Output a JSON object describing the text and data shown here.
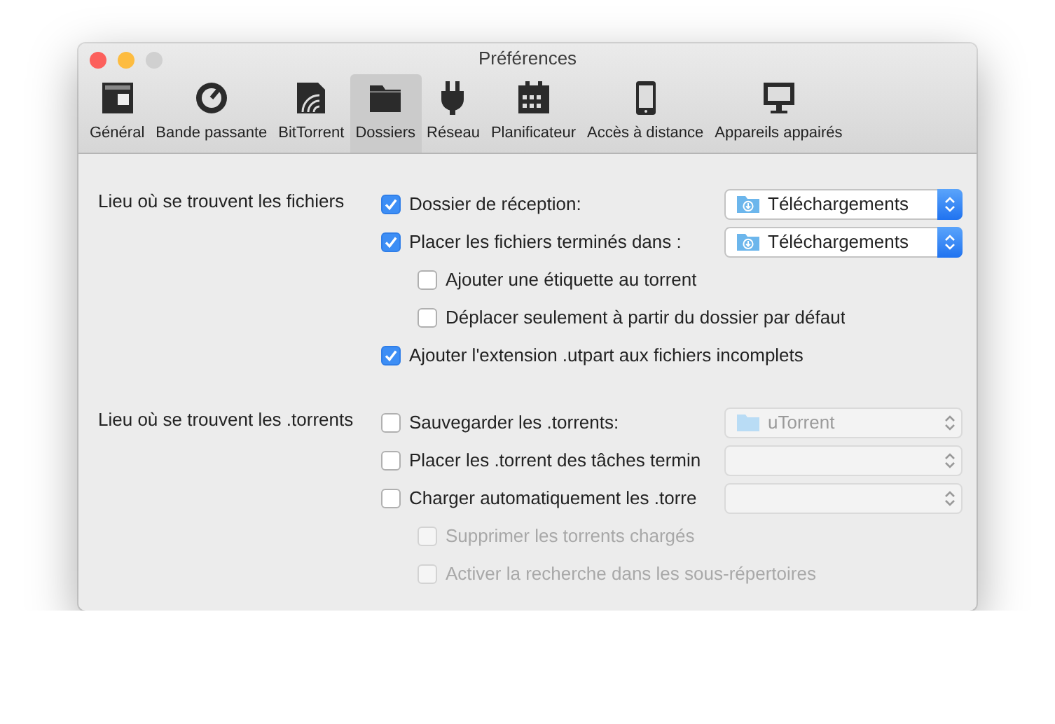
{
  "window": {
    "title": "Préférences"
  },
  "toolbar": [
    {
      "label": "Général",
      "selected": false
    },
    {
      "label": "Bande passante",
      "selected": false
    },
    {
      "label": "BitTorrent",
      "selected": false
    },
    {
      "label": "Dossiers",
      "selected": true
    },
    {
      "label": "Réseau",
      "selected": false
    },
    {
      "label": "Planificateur",
      "selected": false
    },
    {
      "label": "Accès à distance",
      "selected": false
    },
    {
      "label": "Appareils appairés",
      "selected": false
    }
  ],
  "sections": [
    {
      "label": "Lieu où se trouvent les fichiers",
      "options": [
        {
          "label": "Dossier de réception:",
          "checked": true,
          "disabled": false,
          "popup": {
            "value": "Téléchargements",
            "disabled": false
          }
        },
        {
          "label": "Placer les fichiers terminés dans :",
          "checked": true,
          "disabled": false,
          "popup": {
            "value": "Téléchargements",
            "disabled": false
          },
          "children": [
            {
              "label": "Ajouter une étiquette au torrent",
              "checked": false,
              "disabled": false
            },
            {
              "label": "Déplacer seulement à partir du dossier par défaut",
              "checked": false,
              "disabled": false
            }
          ]
        },
        {
          "label": "Ajouter l'extension .utpart aux fichiers incomplets",
          "checked": true,
          "disabled": false
        }
      ]
    },
    {
      "label": "Lieu où se trouvent les .torrents",
      "options": [
        {
          "label": "Sauvegarder les .torrents:",
          "checked": false,
          "disabled": false,
          "popup": {
            "value": "uTorrent",
            "disabled": true
          }
        },
        {
          "label": "Placer les .torrent des tâches termin",
          "checked": false,
          "disabled": false,
          "popup": {
            "disabled": true
          }
        },
        {
          "label": "Charger automatiquement les .torre",
          "checked": false,
          "disabled": false,
          "popup": {
            "disabled": true
          },
          "children": [
            {
              "label": "Supprimer les torrents chargés",
              "checked": false,
              "disabled": true
            },
            {
              "label": "Activer la recherche dans les sous-répertoires",
              "checked": false,
              "disabled": true
            }
          ]
        }
      ]
    }
  ]
}
